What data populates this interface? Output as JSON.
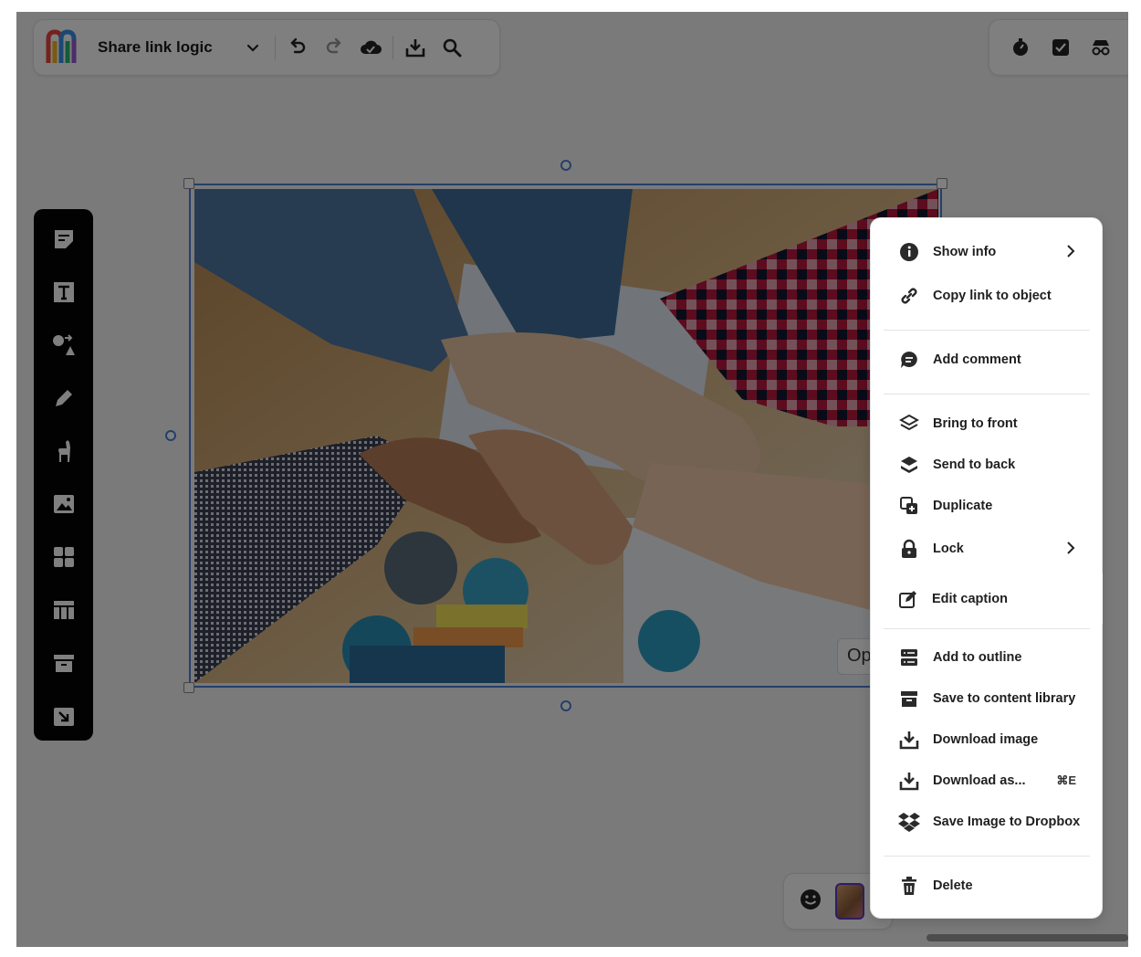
{
  "board": {
    "title": "Share link logic"
  },
  "open_chip": {
    "label": "Op"
  },
  "menu": {
    "items": [
      {
        "label": "Show info",
        "icon": "info-icon",
        "submenu": true
      },
      {
        "label": "Copy link to object",
        "icon": "link-icon"
      },
      {
        "label": "Add comment",
        "icon": "comment-icon"
      },
      {
        "label": "Bring to front",
        "icon": "layers-up-icon"
      },
      {
        "label": "Send to back",
        "icon": "layers-down-icon"
      },
      {
        "label": "Duplicate",
        "icon": "duplicate-icon"
      },
      {
        "label": "Lock",
        "icon": "lock-icon",
        "submenu": true
      },
      {
        "label": "Edit caption",
        "icon": "edit-icon",
        "highlighted": true
      },
      {
        "label": "Add to outline",
        "icon": "outline-icon"
      },
      {
        "label": "Save to content library",
        "icon": "archive-icon"
      },
      {
        "label": "Download image",
        "icon": "download-icon"
      },
      {
        "label": "Download as...",
        "icon": "download-icon",
        "shortcut": "⌘E"
      },
      {
        "label": "Save Image to Dropbox",
        "icon": "dropbox-icon"
      },
      {
        "label": "Delete",
        "icon": "trash-icon"
      }
    ]
  },
  "colors": {
    "selection": "#4a7fd4",
    "toolbar": "#050505",
    "overlay": "rgba(0,0,0,0.5)"
  }
}
